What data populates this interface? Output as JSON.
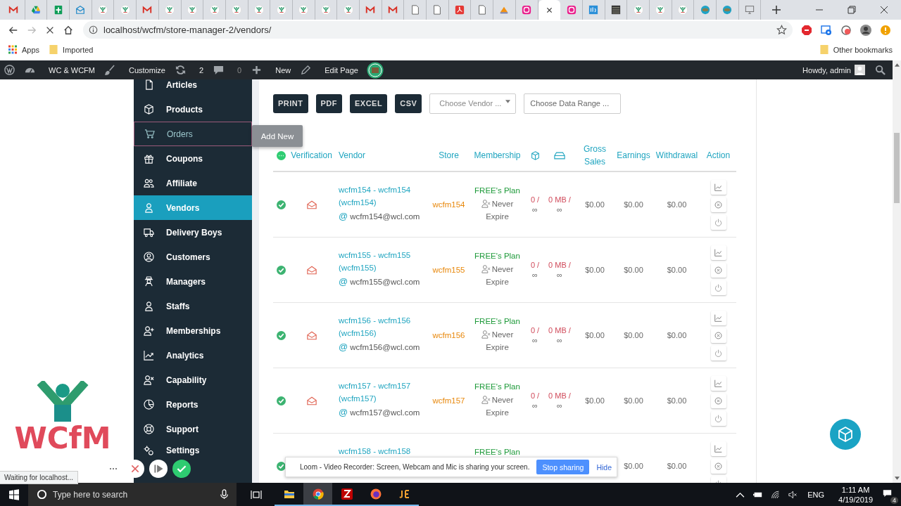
{
  "browser": {
    "tabs": [
      {
        "kind": "gmail",
        "selected": false
      },
      {
        "kind": "drive",
        "selected": false
      },
      {
        "kind": "sheets",
        "selected": false
      },
      {
        "kind": "mail",
        "selected": false
      },
      {
        "kind": "wcfm",
        "selected": false
      },
      {
        "kind": "wcfm",
        "selected": false
      },
      {
        "kind": "gmail",
        "selected": false
      },
      {
        "kind": "wcfm",
        "selected": false
      },
      {
        "kind": "wcfm",
        "selected": false
      },
      {
        "kind": "wcfm",
        "selected": false
      },
      {
        "kind": "wcfm",
        "selected": false
      },
      {
        "kind": "wcfm",
        "selected": false
      },
      {
        "kind": "wcfm",
        "selected": false
      },
      {
        "kind": "wcfm",
        "selected": false
      },
      {
        "kind": "wcfm",
        "selected": false
      },
      {
        "kind": "wcfm",
        "selected": false
      },
      {
        "kind": "gmail",
        "selected": false
      },
      {
        "kind": "gmail",
        "selected": false
      },
      {
        "kind": "doc",
        "selected": false
      },
      {
        "kind": "doc",
        "selected": false
      },
      {
        "kind": "pdf",
        "selected": false
      },
      {
        "kind": "doc",
        "selected": false
      },
      {
        "kind": "pma",
        "selected": false
      },
      {
        "kind": "wamp",
        "selected": false
      },
      {
        "kind": "blank",
        "selected": true
      },
      {
        "kind": "wamp",
        "selected": false
      },
      {
        "kind": "ibb",
        "selected": false
      },
      {
        "kind": "dark",
        "selected": false
      },
      {
        "kind": "wcfm",
        "selected": false
      },
      {
        "kind": "wcfm",
        "selected": false
      },
      {
        "kind": "wcfm",
        "selected": false
      },
      {
        "kind": "globe",
        "selected": false
      },
      {
        "kind": "globe",
        "selected": false
      },
      {
        "kind": "monitor",
        "selected": false
      }
    ],
    "url": "localhost/wcfm/store-manager-2/vendors/",
    "bookmarks": [
      "Apps",
      "Imported"
    ],
    "other_bookmarks": "Other bookmarks"
  },
  "admin_bar": {
    "site": "WC & WCFM",
    "customize": "Customize",
    "updates": "2",
    "comments": "0",
    "new": "New",
    "edit": "Edit Page",
    "greeting": "Howdy, admin"
  },
  "sidebar": {
    "items": [
      {
        "label": "Articles",
        "selected": false,
        "hovered": false
      },
      {
        "label": "Products",
        "selected": false,
        "hovered": false
      },
      {
        "label": "Orders",
        "selected": false,
        "hovered": true
      },
      {
        "label": "Coupons",
        "selected": false,
        "hovered": false
      },
      {
        "label": "Affiliate",
        "selected": false,
        "hovered": false
      },
      {
        "label": "Vendors",
        "selected": true,
        "hovered": false
      },
      {
        "label": "Delivery Boys",
        "selected": false,
        "hovered": false
      },
      {
        "label": "Customers",
        "selected": false,
        "hovered": false
      },
      {
        "label": "Managers",
        "selected": false,
        "hovered": false
      },
      {
        "label": "Staffs",
        "selected": false,
        "hovered": false
      },
      {
        "label": "Memberships",
        "selected": false,
        "hovered": false
      },
      {
        "label": "Analytics",
        "selected": false,
        "hovered": false
      },
      {
        "label": "Capability",
        "selected": false,
        "hovered": false
      },
      {
        "label": "Reports",
        "selected": false,
        "hovered": false
      },
      {
        "label": "Support",
        "selected": false,
        "hovered": false
      },
      {
        "label": "Settings",
        "selected": false,
        "hovered": false
      }
    ]
  },
  "tooltip": "Add New",
  "toolbar": {
    "buttons": [
      "PRINT",
      "PDF",
      "EXCEL",
      "CSV"
    ],
    "vendor_select": {
      "placeholder": "Choose Vendor ..."
    },
    "date_range": {
      "placeholder": "Choose Data Range ..."
    }
  },
  "table": {
    "columns": [
      {
        "kind": "status"
      },
      {
        "kind": "text",
        "label": "Verification"
      },
      {
        "kind": "text",
        "label": "Vendor"
      },
      {
        "kind": "text",
        "label": "Store"
      },
      {
        "kind": "text",
        "label": "Membership"
      },
      {
        "kind": "products"
      },
      {
        "kind": "storage"
      },
      {
        "kind": "text",
        "label": "Gross Sales"
      },
      {
        "kind": "text",
        "label": "Earnings"
      },
      {
        "kind": "text",
        "label": "Withdrawal"
      },
      {
        "kind": "text",
        "label": "Action"
      }
    ],
    "rows": [
      {
        "verified": true,
        "vendor": "wcfm154 - wcfm154 (wcfm154)",
        "email_mark": "@",
        "email": "wcfm154@wcl.com",
        "store": "wcfm154",
        "plan": "FREE's Plan",
        "expiry": "Never Expire",
        "products": "0 /",
        "products_limit": "∞",
        "disk": "0 MB /",
        "disk_limit": "∞",
        "gross_sales": "$0.00",
        "earnings": "$0.00",
        "withdrawal": "$0.00"
      },
      {
        "verified": true,
        "vendor": "wcfm155 - wcfm155 (wcfm155)",
        "email_mark": "@",
        "email": "wcfm155@wcl.com",
        "store": "wcfm155",
        "plan": "FREE's Plan",
        "expiry": "Never Expire",
        "products": "0 /",
        "products_limit": "∞",
        "disk": "0 MB /",
        "disk_limit": "∞",
        "gross_sales": "$0.00",
        "earnings": "$0.00",
        "withdrawal": "$0.00"
      },
      {
        "verified": true,
        "vendor": "wcfm156 - wcfm156 (wcfm156)",
        "email_mark": "@",
        "email": "wcfm156@wcl.com",
        "store": "wcfm156",
        "plan": "FREE's Plan",
        "expiry": "Never Expire",
        "products": "0 /",
        "products_limit": "∞",
        "disk": "0 MB /",
        "disk_limit": "∞",
        "gross_sales": "$0.00",
        "earnings": "$0.00",
        "withdrawal": "$0.00"
      },
      {
        "verified": true,
        "vendor": "wcfm157 - wcfm157 (wcfm157)",
        "email_mark": "@",
        "email": "wcfm157@wcl.com",
        "store": "wcfm157",
        "plan": "FREE's Plan",
        "expiry": "Never Expire",
        "products": "0 /",
        "products_limit": "∞",
        "disk": "0 MB /",
        "disk_limit": "∞",
        "gross_sales": "$0.00",
        "earnings": "$0.00",
        "withdrawal": "$0.00"
      },
      {
        "verified": true,
        "vendor": "wcfm158 - wcfm158",
        "plan": "FREE's Plan",
        "earnings": "$0.00",
        "withdrawal": "$0.00"
      }
    ]
  },
  "logo": {
    "text": "WCfM"
  },
  "loom": {
    "message": "Loom - Video Recorder: Screen, Webcam and Mic is sharing your screen.",
    "stop": "Stop sharing",
    "hide": "Hide"
  },
  "status_bar": "Waiting for localhost...",
  "taskbar": {
    "search": {
      "placeholder": "Type here to search"
    },
    "apps": [
      {
        "kind": "explorer",
        "selected": false
      },
      {
        "kind": "chrome",
        "selected": true
      },
      {
        "kind": "filezilla",
        "selected": false
      },
      {
        "kind": "firefox",
        "selected": false
      },
      {
        "kind": "je",
        "selected": false
      }
    ],
    "language": "ENG",
    "time": "1:11 AM",
    "date": "4/19/2019",
    "notifications": "4"
  }
}
